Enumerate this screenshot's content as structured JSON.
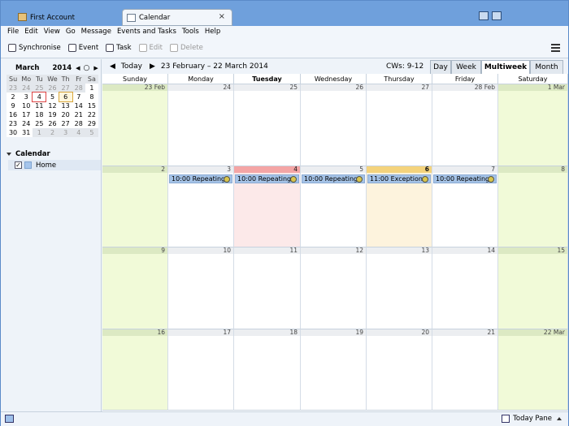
{
  "tabs": [
    {
      "label": "First Account",
      "active": false
    },
    {
      "label": "Calendar",
      "active": true,
      "close": "×"
    }
  ],
  "menu": [
    "File",
    "Edit",
    "View",
    "Go",
    "Message",
    "Events and Tasks",
    "Tools",
    "Help"
  ],
  "toolbar": {
    "synchronise": "Synchronise",
    "event": "Event",
    "task": "Task",
    "edit": "Edit",
    "delete": "Delete"
  },
  "minimonth": {
    "month": "March",
    "year": "2014",
    "weekdays": [
      "Su",
      "Mo",
      "Tu",
      "We",
      "Th",
      "Fr",
      "Sa"
    ],
    "weeks": [
      [
        "23",
        "24",
        "25",
        "26",
        "27",
        "28",
        "1"
      ],
      [
        "2",
        "3",
        "4",
        "5",
        "6",
        "7",
        "8"
      ],
      [
        "9",
        "10",
        "11",
        "12",
        "13",
        "14",
        "15"
      ],
      [
        "16",
        "17",
        "18",
        "19",
        "20",
        "21",
        "22"
      ],
      [
        "23",
        "24",
        "25",
        "26",
        "27",
        "28",
        "29"
      ],
      [
        "30",
        "31",
        "1",
        "2",
        "3",
        "4",
        "5"
      ]
    ],
    "today": "4",
    "selected": "6"
  },
  "calendars": {
    "header": "Calendar",
    "items": [
      {
        "name": "Home",
        "checked": true,
        "color": "#a5c5ec"
      }
    ]
  },
  "nav": {
    "today": "Today",
    "range": "23 February – 22 March 2014",
    "cws": "CWs: 9-12"
  },
  "views": [
    "Day",
    "Week",
    "Multiweek",
    "Month"
  ],
  "active_view": "Multiweek",
  "dow": [
    "Sunday",
    "Monday",
    "Tuesday",
    "Wednesday",
    "Thursday",
    "Friday",
    "Saturday"
  ],
  "weeks": [
    [
      "23 Feb",
      "24",
      "25",
      "26",
      "27",
      "28 Feb",
      "1 Mar"
    ],
    [
      "2",
      "3",
      "4",
      "5",
      "6",
      "7",
      "8"
    ],
    [
      "9",
      "10",
      "11",
      "12",
      "13",
      "14",
      "15"
    ],
    [
      "16",
      "17",
      "18",
      "19",
      "20",
      "21",
      "22 Mar"
    ]
  ],
  "events": [
    {
      "week": 1,
      "day": 1,
      "label": "10:00 Repeating"
    },
    {
      "week": 1,
      "day": 2,
      "label": "10:00 Repeating"
    },
    {
      "week": 1,
      "day": 3,
      "label": "10:00 Repeating"
    },
    {
      "week": 1,
      "day": 4,
      "label": "11:00 Exception"
    },
    {
      "week": 1,
      "day": 5,
      "label": "10:00 Repeating"
    }
  ],
  "today_cell": {
    "week": 1,
    "day": 2
  },
  "selected_cell": {
    "week": 1,
    "day": 4
  },
  "statusbar": {
    "today_pane": "Today Pane"
  }
}
